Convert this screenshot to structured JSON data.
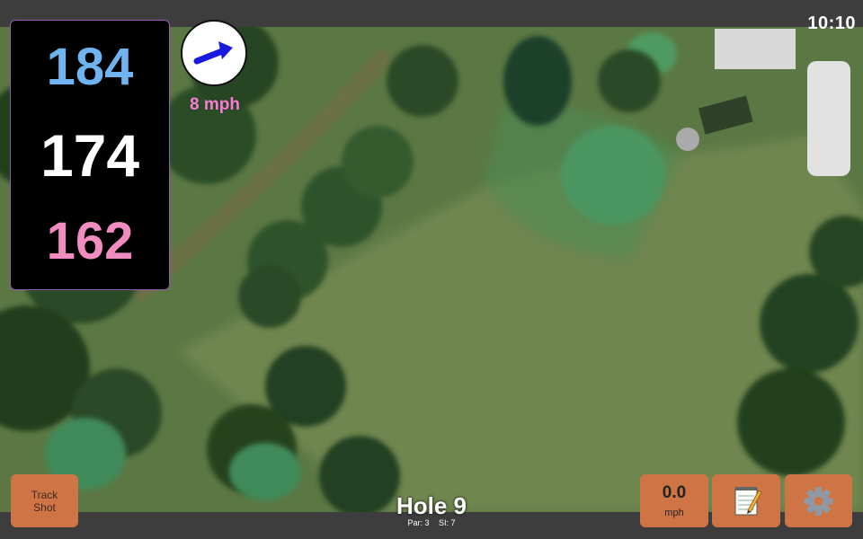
{
  "status": {
    "time": "10:10"
  },
  "yardages": {
    "back": "184",
    "middle": "174",
    "front": "162"
  },
  "wind": {
    "speed": "8 mph",
    "arrow_color": "#1a1adf"
  },
  "buttons": {
    "track_shot": "Track\nShot",
    "speed_value": "0.0",
    "speed_unit": "mph",
    "notes_icon": "notepad-icon",
    "settings_icon": "gear-icon"
  },
  "hole": {
    "title": "Hole 9",
    "par": "Par: 3",
    "si": "SI: 7"
  },
  "colors": {
    "button": "#cf7444",
    "back_yardage": "#6fb3f0",
    "front_yardage": "#f08cc0",
    "wind_text": "#f47fd0"
  }
}
